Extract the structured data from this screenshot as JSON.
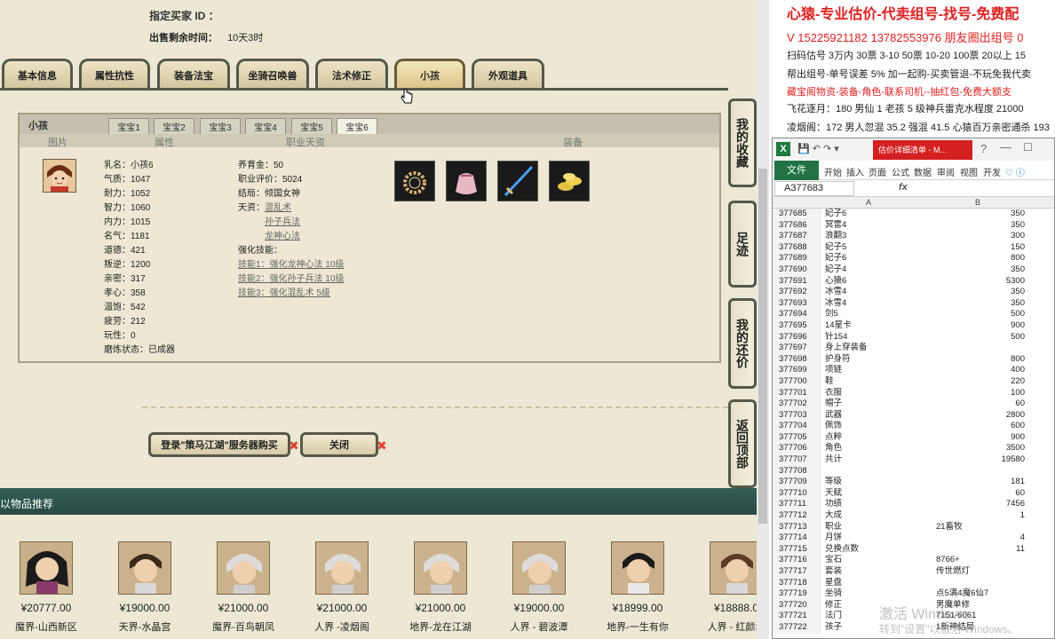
{
  "header": {
    "buyer_id_label": "指定买家 ID ：",
    "remaining_label": "出售剩余时间：",
    "remaining_value": "10天3时"
  },
  "tabs": [
    "基本信息",
    "属性抗性",
    "装备法宝",
    "坐骑召唤兽",
    "法术修正",
    "小孩",
    "外观道具"
  ],
  "active_tab": "小孩",
  "panel": {
    "title": "小孩",
    "subtabs": [
      "宝宝1",
      "宝宝2",
      "宝宝3",
      "宝宝4",
      "宝宝5",
      "宝宝6"
    ],
    "active_subtab": "宝宝6",
    "col_headers": [
      "图片",
      "属性",
      "职业天资",
      "装备"
    ],
    "stats": [
      "乳名：小孩6",
      "气质：1047",
      "耐力：1052",
      "智力：1060",
      "内力：1015",
      "名气：1181",
      "道德：421",
      "叛逆：1200",
      "亲密：317",
      "孝心：358",
      "温饱：542",
      "疲劳：212",
      "玩性：0",
      "磨炼状态：已成器"
    ],
    "col2_lines": [
      "养育金：50",
      "职业评价：5024",
      "结局：倾国女神"
    ],
    "tianzi_label": "天资：",
    "tianzi": [
      "混乱术",
      "孙子兵法",
      "龙神心法"
    ],
    "strengthen_label": "强化技能：",
    "strengthen": [
      "技能1：强化龙神心法 10级",
      "技能2：强化孙子兵法 10级",
      "技能3：强化混乱术 5级"
    ],
    "equip_icons": [
      "ring-item-icon",
      "pouch-item-icon",
      "sword-item-icon",
      "gold-item-icon"
    ]
  },
  "buttons": {
    "login": "登录\"策马江湖\"服务器购买",
    "close": "关闭"
  },
  "side_buttons": [
    "我的收藏",
    "足迹",
    "我的还价",
    "返回顶部"
  ],
  "recommend": {
    "title": "以物品推荐",
    "items": [
      {
        "price": "¥20777.00",
        "server": "魔界-山西新区"
      },
      {
        "price": "¥19000.00",
        "server": "天界-水晶宫"
      },
      {
        "price": "¥21000.00",
        "server": "魔界-百鸟朝凤"
      },
      {
        "price": "¥21000.00",
        "server": "人界 -凌烟阁"
      },
      {
        "price": "¥21000.00",
        "server": "地界-龙在江湖"
      },
      {
        "price": "¥19000.00",
        "server": "人界 - 碧波潭"
      },
      {
        "price": "¥18999.00",
        "server": "地界-一生有你"
      },
      {
        "price": "¥18888.0",
        "server": "人界 - 红颜坊"
      }
    ]
  },
  "ad": {
    "line1": "心猿-专业估价-代卖组号-找号-免费配",
    "line2": "V 15225921182   13782553976 朋友圈出组号 0",
    "line3": "扫码估号 3万内 30票  3-10 50票  10-20 100票 20以上 15",
    "line4": "帮出组号-单号误差 5% 加一起购-买卖管退-不玩免我代卖",
    "line5": "藏宝阁物资-装备-角色-联系司机--抽红包-免费大额支",
    "line6": "飞花逐月：180 男仙 1 老孩 5 级神兵雷克水程度 21000",
    "line7": "凌烟阁：172 男人忽混 35.2 强混 41.5 心猿百万亲密通杀 193"
  },
  "excel": {
    "title_tab": "估价详细清单 - M...",
    "ribbon": [
      "文件",
      "开始",
      "插入",
      "页面",
      "公式",
      "数据",
      "审阅",
      "视图",
      "开发"
    ],
    "name_box": "A377683",
    "fx": "fx",
    "col_a": "A",
    "col_b": "B",
    "rows": [
      [
        "377685",
        "妃子6",
        "350"
      ],
      [
        "377686",
        "冥雷4",
        "350"
      ],
      [
        "377687",
        "浪翻3",
        "300"
      ],
      [
        "377688",
        "妃子5",
        "150"
      ],
      [
        "377689",
        "妃子6",
        "800"
      ],
      [
        "377690",
        "妃子4",
        "350"
      ],
      [
        "377691",
        "心猿6",
        "5300"
      ],
      [
        "377692",
        "冰雪4",
        "350"
      ],
      [
        "377693",
        "冰雪4",
        "350"
      ],
      [
        "377694",
        "剑5",
        "500"
      ],
      [
        "377695",
        "14星卡",
        "900"
      ],
      [
        "377696",
        "针154",
        "500"
      ],
      [
        "377697",
        "身上穿装备",
        ""
      ],
      [
        "377698",
        "护身符",
        "800"
      ],
      [
        "377699",
        "项链",
        "400"
      ],
      [
        "377700",
        "鞋",
        "220"
      ],
      [
        "377701",
        "衣服",
        "100"
      ],
      [
        "377702",
        "帽子",
        "60"
      ],
      [
        "377703",
        "武器",
        "2800"
      ],
      [
        "377704",
        "佩饰",
        "600"
      ],
      [
        "377705",
        "点粹",
        "900"
      ],
      [
        "377706",
        "角色",
        "3500"
      ],
      [
        "377707",
        "共计",
        "19580"
      ],
      [
        "377708",
        "",
        ""
      ],
      [
        "377709",
        "等级",
        "181"
      ],
      [
        "377710",
        "天赋",
        "60"
      ],
      [
        "377711",
        "功绩",
        "7456"
      ],
      [
        "377712",
        "大成",
        "1"
      ],
      [
        "377713",
        "职业",
        "21畜牧"
      ],
      [
        "377714",
        "月饼",
        "4"
      ],
      [
        "377715",
        "兑换点数",
        "11"
      ],
      [
        "377716",
        "宝石",
        "8766+"
      ],
      [
        "377717",
        "套装",
        "传世燃灯"
      ],
      [
        "377718",
        "星盘",
        ""
      ],
      [
        "377719",
        "坐骑",
        "点5满4魔6仙7"
      ],
      [
        "377720",
        "修正",
        "男魔单修"
      ],
      [
        "377721",
        "法门",
        "7151-6061"
      ],
      [
        "377722",
        "孩子",
        "1新神结局"
      ]
    ]
  },
  "watermark": {
    "line1": "激活 Windows",
    "line2": "转到\"设置\"以激活 Windows。"
  }
}
